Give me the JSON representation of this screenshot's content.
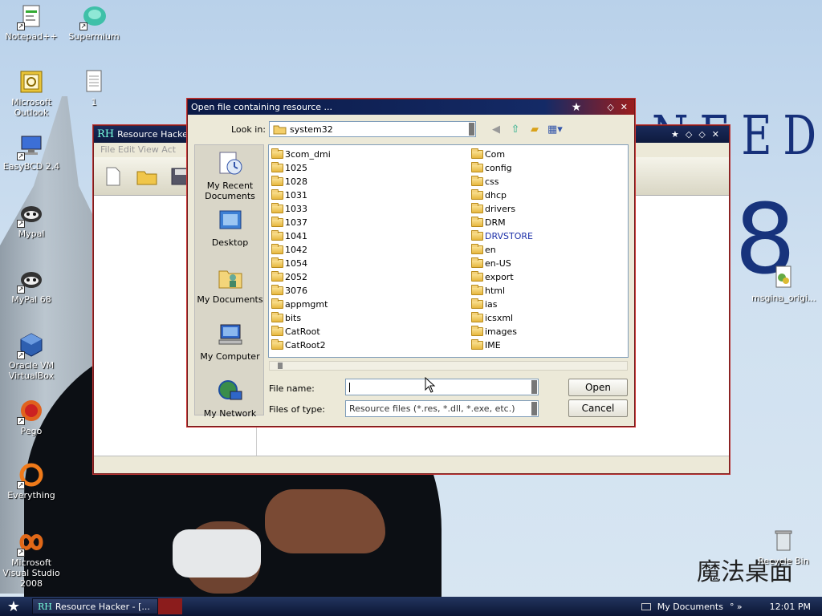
{
  "desktop": {
    "icons": [
      {
        "label": "Notepad++"
      },
      {
        "label": "Supermium"
      },
      {
        "label": "Microsoft Outlook"
      },
      {
        "label": "1"
      },
      {
        "label": "EasyBCD 2.4"
      },
      {
        "label": "Mypal"
      },
      {
        "label": "MyPal 68"
      },
      {
        "label": "Oracle VM VirtualBox"
      },
      {
        "label": "Pego"
      },
      {
        "label": "Everything"
      },
      {
        "label": "Microsoft Visual Studio 2008"
      },
      {
        "label": "msgina_origi..."
      },
      {
        "label": "Recycle Bin"
      }
    ],
    "wallpaper_text": {
      "need": "NEED",
      "eight": "8",
      "brand": "魔法桌面"
    }
  },
  "resource_hacker": {
    "title": "Resource Hacker - [",
    "logo": "RH",
    "menu": "File  Edit  View  Act"
  },
  "dialog": {
    "title": "Open file containing resource ...",
    "look_in_label": "Look in:",
    "look_in_value": "system32",
    "places": [
      {
        "label": "My Recent Documents",
        "icon": "recent-documents-icon"
      },
      {
        "label": "Desktop",
        "icon": "desktop-icon"
      },
      {
        "label": "My Documents",
        "icon": "my-documents-icon"
      },
      {
        "label": "My Computer",
        "icon": "my-computer-icon"
      },
      {
        "label": "My Network",
        "icon": "my-network-icon"
      }
    ],
    "folders_col1": [
      "3com_dmi",
      "1025",
      "1028",
      "1031",
      "1033",
      "1037",
      "1041",
      "1042",
      "1054",
      "2052",
      "3076",
      "appmgmt",
      "bits",
      "CatRoot",
      "CatRoot2"
    ],
    "folders_col2": [
      "Com",
      "config",
      "css",
      "dhcp",
      "drivers",
      "DRM",
      "DRVSTORE",
      "en",
      "en-US",
      "export",
      "html",
      "ias",
      "icsxml",
      "images",
      "IME"
    ],
    "highlight_folder": "DRVSTORE",
    "file_name_label": "File name:",
    "file_name_value": "",
    "files_of_type_label": "Files of type:",
    "files_of_type_value": "Resource files (*.res, *.dll, *.exe, etc.)",
    "open_label": "Open",
    "cancel_label": "Cancel"
  },
  "taskbar": {
    "task_label": "Resource Hacker - [...",
    "task_logo": "RH",
    "my_documents": "My Documents",
    "tray_arrows": "° »",
    "clock": "12:01 PM"
  },
  "colors": {
    "title_blue": "#0b1a46",
    "accent_red": "#9b1d1d",
    "link_blue": "#1b2fa8"
  }
}
